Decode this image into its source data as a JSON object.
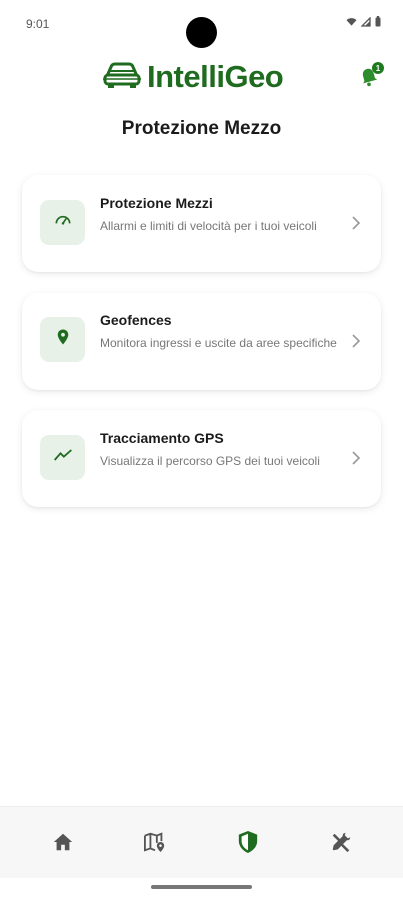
{
  "status_bar": {
    "time": "9:01"
  },
  "app": {
    "logo_text": "IntelliGeo",
    "notification_count": "1"
  },
  "page": {
    "title": "Protezione Mezzo"
  },
  "cards": [
    {
      "title": "Protezione Mezzi",
      "description": "Allarmi e limiti di velocità per i tuoi veicoli",
      "icon": "speedometer-icon"
    },
    {
      "title": "Geofences",
      "description": "Monitora ingressi e uscite da aree specifiche",
      "icon": "location-pin-icon"
    },
    {
      "title": "Tracciamento GPS",
      "description": "Visualizza il percorso GPS dei tuoi veicoli",
      "icon": "trending-line-icon"
    }
  ],
  "bottom_nav": {
    "items": [
      {
        "icon": "home-icon",
        "active": false
      },
      {
        "icon": "map-pin-icon",
        "active": false
      },
      {
        "icon": "shield-icon",
        "active": true
      },
      {
        "icon": "tools-icon",
        "active": false
      }
    ]
  },
  "colors": {
    "accent": "#1f6b1f",
    "icon_bg": "#e8f1e8",
    "inactive": "#555555"
  }
}
